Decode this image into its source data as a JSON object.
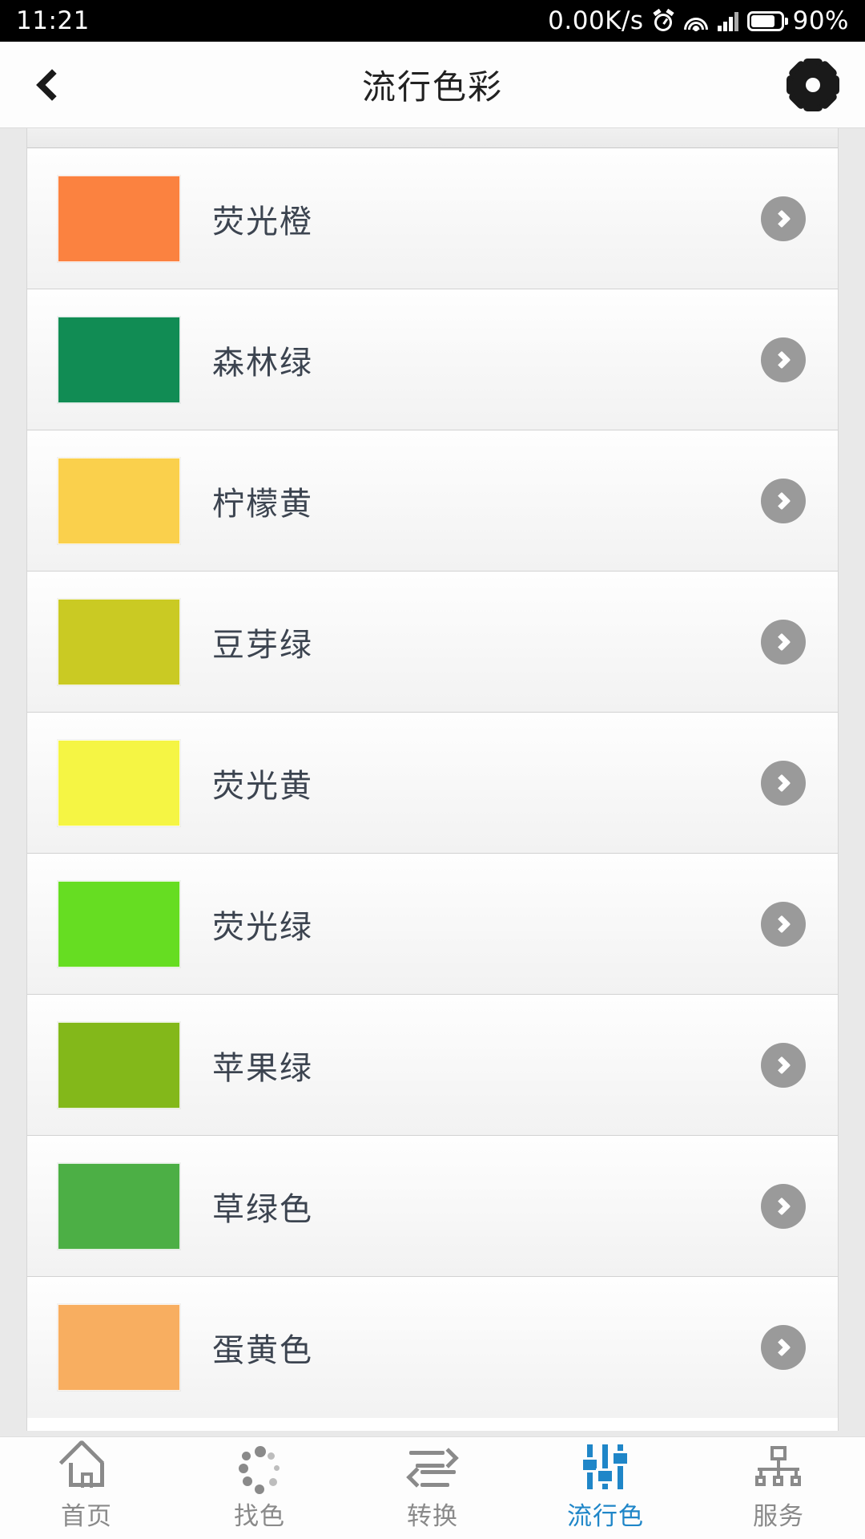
{
  "status_bar": {
    "time": "11:21",
    "network_speed": "0.00K/s",
    "battery_percent": "90%",
    "icons": [
      "alarm-icon",
      "wifi-icon",
      "signal-icon",
      "battery-icon"
    ]
  },
  "header": {
    "title": "流行色彩",
    "back_icon": "chevron-left-icon",
    "settings_icon": "gear-icon"
  },
  "list": {
    "items": [
      {
        "label": "荧光橙",
        "color": "#FB8240"
      },
      {
        "label": "森林绿",
        "color": "#118C54"
      },
      {
        "label": "柠檬黄",
        "color": "#FAD04C"
      },
      {
        "label": "豆芽绿",
        "color": "#CACA23"
      },
      {
        "label": "荧光黄",
        "color": "#F5F544"
      },
      {
        "label": "荧光绿",
        "color": "#66DD22"
      },
      {
        "label": "苹果绿",
        "color": "#83B81A"
      },
      {
        "label": "草绿色",
        "color": "#4CAF45"
      },
      {
        "label": "蛋黄色",
        "color": "#F8AE60"
      }
    ],
    "arrow_icon": "chevron-right-icon"
  },
  "bottom_nav": {
    "active_color": "#1F86C8",
    "inactive_color": "#8A8A8A",
    "items": [
      {
        "label": "首页",
        "icon": "home-icon",
        "active": false
      },
      {
        "label": "找色",
        "icon": "dots-icon",
        "active": false
      },
      {
        "label": "转换",
        "icon": "swap-icon",
        "active": false
      },
      {
        "label": "流行色",
        "icon": "sliders-icon",
        "active": true
      },
      {
        "label": "服务",
        "icon": "org-icon",
        "active": false
      }
    ]
  }
}
